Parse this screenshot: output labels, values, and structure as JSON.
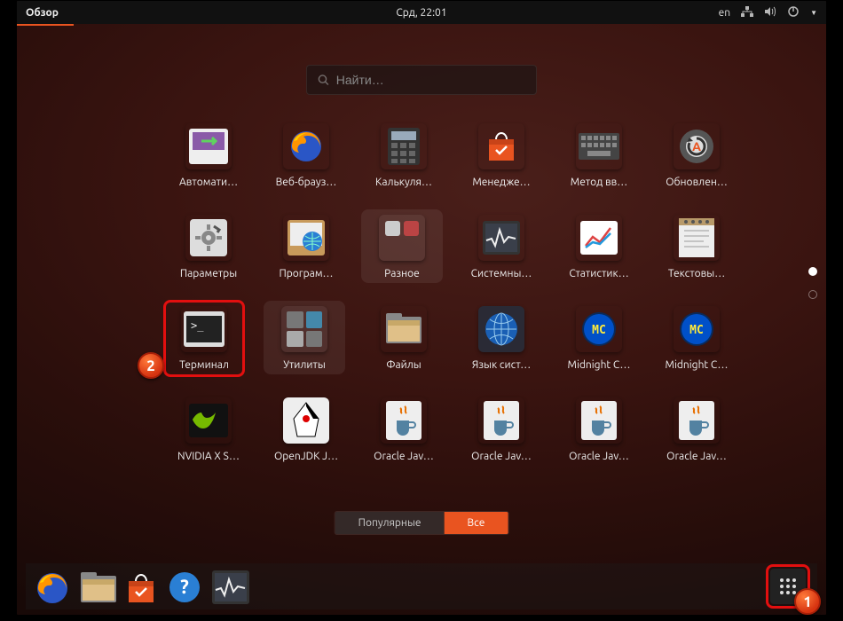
{
  "topbar": {
    "activities": "Обзор",
    "clock": "Срд, 22:01",
    "lang": "en"
  },
  "search": {
    "placeholder": "Найти…"
  },
  "apps": [
    {
      "label": "Автомати…",
      "icon": "update-violet",
      "semantic": "automation"
    },
    {
      "label": "Веб-брауз…",
      "icon": "firefox",
      "semantic": "web-browser"
    },
    {
      "label": "Калькуля…",
      "icon": "calculator",
      "semantic": "calculator"
    },
    {
      "label": "Менедже…",
      "icon": "software-bag",
      "semantic": "software-manager"
    },
    {
      "label": "Метод вв…",
      "icon": "keyboard",
      "semantic": "input-method"
    },
    {
      "label": "Обновлен…",
      "icon": "updater",
      "semantic": "software-updater"
    },
    {
      "label": "Параметры",
      "icon": "settings",
      "semantic": "settings"
    },
    {
      "label": "Програм…",
      "icon": "software-globe",
      "semantic": "software-sources"
    },
    {
      "label": "Разное",
      "icon": "folder-misc",
      "semantic": "misc-folder",
      "folder": true
    },
    {
      "label": "Системны…",
      "icon": "sysmon",
      "semantic": "system-monitor"
    },
    {
      "label": "Статистик…",
      "icon": "stats",
      "semantic": "statistics"
    },
    {
      "label": "Текстовы…",
      "icon": "texteditor",
      "semantic": "text-editor"
    },
    {
      "label": "Терминал",
      "icon": "terminal",
      "semantic": "terminal",
      "highlight": true
    },
    {
      "label": "Утилиты",
      "icon": "folder-utils",
      "semantic": "utilities-folder",
      "folder": true
    },
    {
      "label": "Файлы",
      "icon": "files",
      "semantic": "files"
    },
    {
      "label": "Язык сист…",
      "icon": "language",
      "semantic": "language"
    },
    {
      "label": "Midnight C…",
      "icon": "mc-blue",
      "semantic": "midnight-commander"
    },
    {
      "label": "Midnight C…",
      "icon": "mc-blue",
      "semantic": "midnight-commander-alt"
    },
    {
      "label": "NVIDIA X S…",
      "icon": "nvidia",
      "semantic": "nvidia-settings"
    },
    {
      "label": "OpenJDK J…",
      "icon": "java-duke",
      "semantic": "openjdk"
    },
    {
      "label": "Oracle Jav…",
      "icon": "java-cup",
      "semantic": "oracle-java-1"
    },
    {
      "label": "Oracle Jav…",
      "icon": "java-cup",
      "semantic": "oracle-java-2"
    },
    {
      "label": "Oracle Jav…",
      "icon": "java-cup",
      "semantic": "oracle-java-3"
    },
    {
      "label": "Oracle Jav…",
      "icon": "java-cup",
      "semantic": "oracle-java-4"
    }
  ],
  "toggle": {
    "frequent": "Популярные",
    "all": "Все",
    "active": "all"
  },
  "dock": [
    {
      "icon": "firefox",
      "semantic": "firefox"
    },
    {
      "icon": "files",
      "semantic": "files"
    },
    {
      "icon": "software-bag",
      "semantic": "ubuntu-software"
    },
    {
      "icon": "help",
      "semantic": "help"
    },
    {
      "icon": "sysmon",
      "semantic": "system-monitor"
    }
  ],
  "badges": {
    "one": "1",
    "two": "2"
  },
  "colors": {
    "accent": "#e95420",
    "highlight": "#e20f0f"
  }
}
